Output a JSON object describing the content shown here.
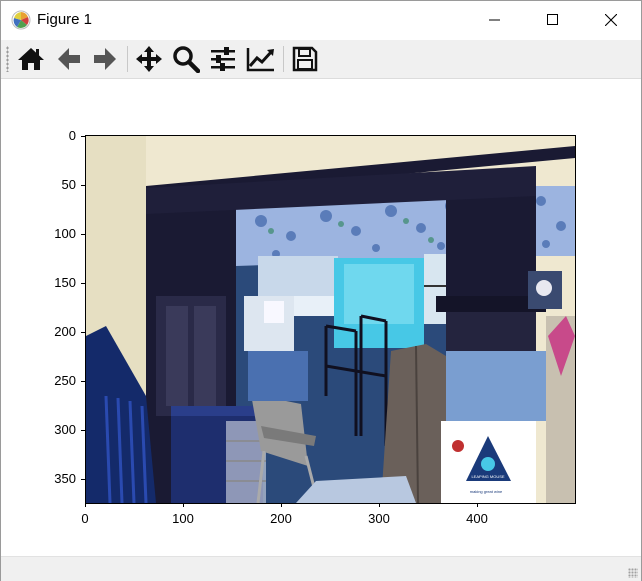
{
  "window": {
    "title": "Figure 1",
    "icon": "matplotlib-icon",
    "controls": [
      "minimize-icon",
      "maximize-icon",
      "close-icon"
    ]
  },
  "toolbar": {
    "buttons": [
      {
        "name": "home-button",
        "icon": "home-icon"
      },
      {
        "name": "back-button",
        "icon": "arrow-left-icon"
      },
      {
        "name": "forward-button",
        "icon": "arrow-right-icon"
      },
      {
        "name": "pan-button",
        "icon": "move-icon"
      },
      {
        "name": "zoom-button",
        "icon": "magnifier-icon"
      },
      {
        "name": "configure-subplots-button",
        "icon": "sliders-icon"
      },
      {
        "name": "edit-axes-button",
        "icon": "line-chart-icon"
      },
      {
        "name": "save-button",
        "icon": "floppy-disk-icon"
      }
    ]
  },
  "plot": {
    "image_description_icon": "photo-of-room",
    "y_ticks": [
      "0",
      "50",
      "100",
      "150",
      "200",
      "250",
      "300",
      "350"
    ],
    "x_ticks": [
      "0",
      "100",
      "200",
      "300",
      "400"
    ],
    "image_text": {
      "box_logo": "LEAPING MOUSE",
      "box_tagline": "making great wine"
    }
  },
  "colors": {
    "wall": "#efe8d0",
    "trim": "#1a1a33",
    "wallpaper": "#9cb4e0",
    "accent_cyan": "#47c8e6"
  }
}
